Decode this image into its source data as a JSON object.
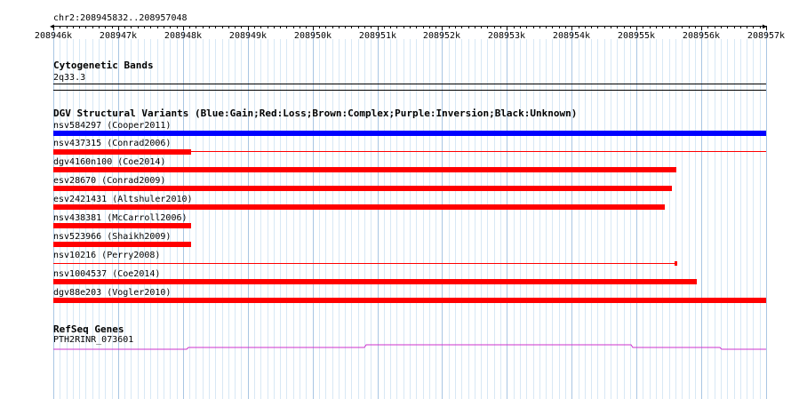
{
  "locus": "chr2:208945832..208957048",
  "ruler": {
    "ticks": [
      "208946k",
      "208947k",
      "208948k",
      "208949k",
      "208950k",
      "208951k",
      "208952k",
      "208953k",
      "208954k",
      "208955k",
      "208956k",
      "208957k"
    ]
  },
  "cyto": {
    "title": "Cytogenetic Bands",
    "band": "2q33.3"
  },
  "dgv": {
    "title": "DGV Structural Variants (Blue:Gain;Red:Loss;Brown:Complex;Purple:Inversion;Black:Unknown)",
    "colors": {
      "gain": "#0000ff",
      "loss": "#ff0000"
    },
    "variants": [
      {
        "label": "nsv584297 (Cooper2011)",
        "type": "gain"
      },
      {
        "label": "nsv437315 (Conrad2006)",
        "type": "loss"
      },
      {
        "label": "dgv4160n100 (Coe2014)",
        "type": "loss"
      },
      {
        "label": "esv28670 (Conrad2009)",
        "type": "loss"
      },
      {
        "label": "esv2421431 (Altshuler2010)",
        "type": "loss"
      },
      {
        "label": "nsv438381 (McCarroll2006)",
        "type": "loss"
      },
      {
        "label": "nsv523966 (Shaikh2009)",
        "type": "loss"
      },
      {
        "label": "nsv10216 (Perry2008)",
        "type": "loss"
      },
      {
        "label": "nsv1004537 (Coe2014)",
        "type": "loss"
      },
      {
        "label": "dgv88e203 (Vogler2010)",
        "type": "loss"
      }
    ]
  },
  "refseq": {
    "title": "RefSeq Genes",
    "gene": "PTH2RINR_073601",
    "color": "#cc33cc"
  }
}
